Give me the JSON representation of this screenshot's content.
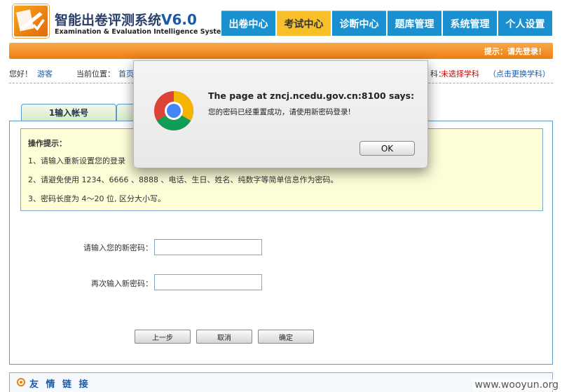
{
  "header": {
    "title_cn": "智能出卷评测系统",
    "version": "V6.0",
    "title_en": "Examination & Evaluation Intelligence System",
    "logo_icon": "logo-icon"
  },
  "nav": {
    "tabs": [
      {
        "label": "出卷中心",
        "active": false
      },
      {
        "label": "考试中心",
        "active": true
      },
      {
        "label": "诊断中心",
        "active": false
      },
      {
        "label": "题库管理",
        "active": false
      },
      {
        "label": "系统管理",
        "active": false
      },
      {
        "label": "个人设置",
        "active": false
      }
    ]
  },
  "notice": {
    "hint": "提示：请先登录！"
  },
  "info": {
    "greeting": "您好！",
    "user": "游客",
    "location_label": "当前位置：",
    "location_value": "首页",
    "subject_suffix": "科：",
    "subject_value": "未选择学科",
    "change_subject": "（点击更换学科）"
  },
  "steps": {
    "step1": "1输入帐号"
  },
  "tips": {
    "title": "操作提示：",
    "line1": "1、请输入重新设置您的登录",
    "line2": "2、请避免使用 1234、6666 、8888 、电话、生日、姓名、纯数字等简单信息作为密码。",
    "line3": "3、密码长度为 4～20 位,  区分大小写。"
  },
  "form": {
    "new_password_label": "请输入您的新密码：",
    "new_password_value": "",
    "confirm_password_label": "再次输入新密码：",
    "confirm_password_value": ""
  },
  "buttons": {
    "prev": "上一步",
    "cancel": "取消",
    "confirm": "确定"
  },
  "footer": {
    "friend_links": "友 情 链 接",
    "watermark": "www.wooyun.org"
  },
  "dialog": {
    "title": "The page at zncj.ncedu.gov.cn:8100 says:",
    "message": "您的密码已经重置成功，请使用新密码登录!",
    "ok": "OK",
    "icon": "chrome-icon"
  },
  "colors": {
    "nav_blue": "#1a90d0",
    "nav_active": "#f7c02a",
    "orange": "#ee7e10",
    "tips_bg": "#fdfdd8"
  }
}
